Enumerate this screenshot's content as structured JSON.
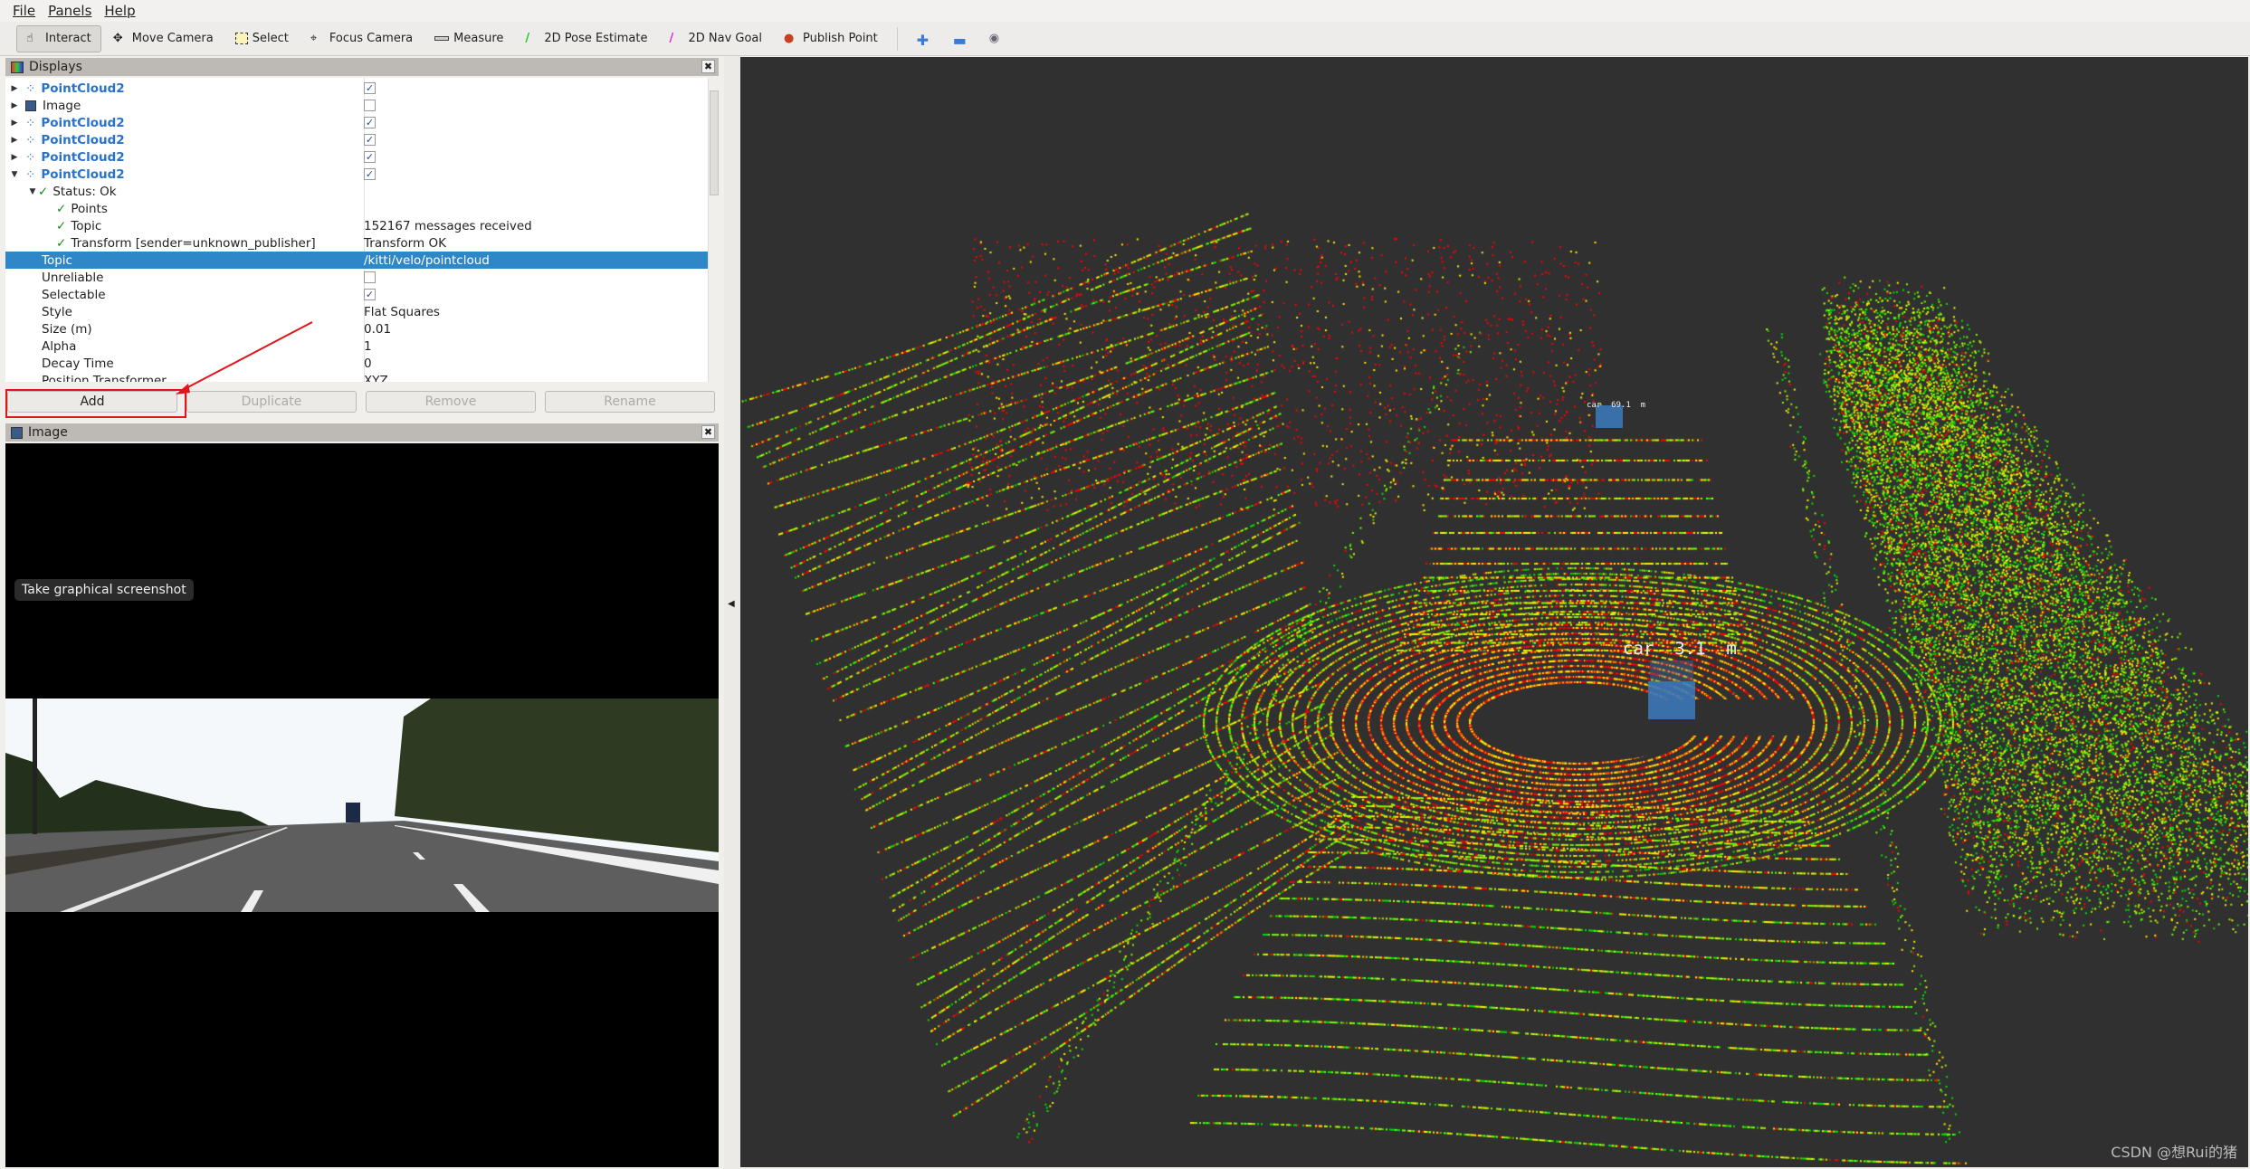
{
  "menu": [
    "File",
    "Panels",
    "Help"
  ],
  "toolbar": [
    {
      "label": "Interact",
      "icon": "hand-icon",
      "active": true
    },
    {
      "label": "Move Camera",
      "icon": "move-camera-icon"
    },
    {
      "label": "Select",
      "icon": "select-icon"
    },
    {
      "label": "Focus Camera",
      "icon": "focus-camera-icon"
    },
    {
      "label": "Measure",
      "icon": "ruler-icon"
    },
    {
      "label": "2D Pose Estimate",
      "icon": "green-arrow-icon"
    },
    {
      "label": "2D Nav Goal",
      "icon": "magenta-arrow-icon"
    },
    {
      "label": "Publish Point",
      "icon": "map-pin-icon"
    }
  ],
  "displays": {
    "title": "Displays",
    "rows": [
      {
        "name": "PointCloud2",
        "type": "pc",
        "checked": true,
        "expand": "closed",
        "indent": 0
      },
      {
        "name": "Image",
        "type": "img",
        "checked": false,
        "expand": "closed",
        "indent": 0
      },
      {
        "name": "PointCloud2",
        "type": "pc",
        "checked": true,
        "expand": "closed",
        "indent": 0
      },
      {
        "name": "PointCloud2",
        "type": "pc",
        "checked": true,
        "expand": "closed",
        "indent": 0
      },
      {
        "name": "PointCloud2",
        "type": "pc",
        "checked": true,
        "expand": "closed",
        "indent": 0
      },
      {
        "name": "PointCloud2",
        "type": "pc",
        "checked": true,
        "expand": "open",
        "indent": 0
      },
      {
        "name": "Status: Ok",
        "type": "ok",
        "expand": "open",
        "indent": 1
      },
      {
        "name": "Points",
        "type": "ok",
        "indent": 2
      },
      {
        "name": "Topic",
        "type": "ok",
        "indent": 2,
        "value": "152167 messages received"
      },
      {
        "name": "Transform [sender=unknown_publisher]",
        "type": "ok",
        "indent": 2,
        "value": "Transform OK"
      },
      {
        "name": "Topic",
        "type": "prop",
        "value": "/kitti/velo/pointcloud",
        "selected": true
      },
      {
        "name": "Unreliable",
        "type": "prop",
        "checked": false
      },
      {
        "name": "Selectable",
        "type": "prop",
        "checked": true
      },
      {
        "name": "Style",
        "type": "prop",
        "value": "Flat Squares"
      },
      {
        "name": "Size (m)",
        "type": "prop",
        "value": "0.01"
      },
      {
        "name": "Alpha",
        "type": "prop",
        "value": "1"
      },
      {
        "name": "Decay Time",
        "type": "prop",
        "value": "0"
      },
      {
        "name": "Position Transformer",
        "type": "prop",
        "value": "XYZ"
      }
    ],
    "buttons": {
      "add": "Add",
      "duplicate": "Duplicate",
      "remove": "Remove",
      "rename": "Rename"
    }
  },
  "image_panel": {
    "title": "Image",
    "tooltip": "Take graphical screenshot"
  },
  "view3d": {
    "labels": [
      {
        "text": "car  69.1  m"
      },
      {
        "text": "car  3.1  m"
      }
    ],
    "background": "#303030",
    "point_colors": [
      "#ff0000",
      "#ffee00",
      "#7cfc00",
      "#00e000"
    ],
    "watermark": "CSDN @想Rui的猪"
  }
}
